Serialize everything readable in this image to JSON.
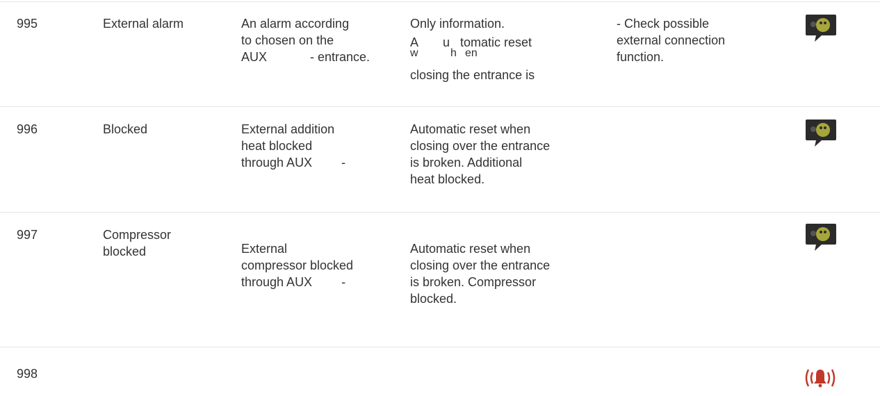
{
  "rows": [
    {
      "code": "995",
      "name": [
        "External alarm"
      ],
      "desc": [
        "An alarm according",
        "to chosen on the"
      ],
      "desc_aux": "AUX",
      "desc_tail": "- entrance.",
      "act_first": "Only information.",
      "act_frag": [
        "A",
        "u",
        "tomatic reset",
        "w",
        "h",
        "en"
      ],
      "act_last": "closing the entrance is",
      "fix": [
        "- Check possible",
        "external connection",
        "function."
      ],
      "icon": "speech-bubble-icon"
    },
    {
      "code": "996",
      "name": [
        "Blocked"
      ],
      "desc": [
        "External addition",
        "heat blocked"
      ],
      "desc_aux": "through AUX",
      "desc_tail": "-",
      "act": [
        "Automatic reset when",
        "closing over the entrance",
        "is broken. Additional",
        "heat blocked."
      ],
      "icon": "speech-bubble-icon"
    },
    {
      "code": "997",
      "name": [
        "Compressor",
        "blocked"
      ],
      "desc": [
        "External",
        "compressor blocked"
      ],
      "desc_aux": "through AUX",
      "desc_tail": "-",
      "act": [
        "Automatic reset when",
        "closing over the entrance",
        "is broken. Compressor",
        "blocked."
      ],
      "icon": "speech-bubble-icon"
    },
    {
      "code": "998",
      "icon": "alarm-bell-icon"
    }
  ],
  "colors": {
    "text": "#333333",
    "divider": "#e6e6e6",
    "bubble": "#2b2b2b",
    "face": "#a7a63a",
    "alarm": "#c0392b"
  }
}
